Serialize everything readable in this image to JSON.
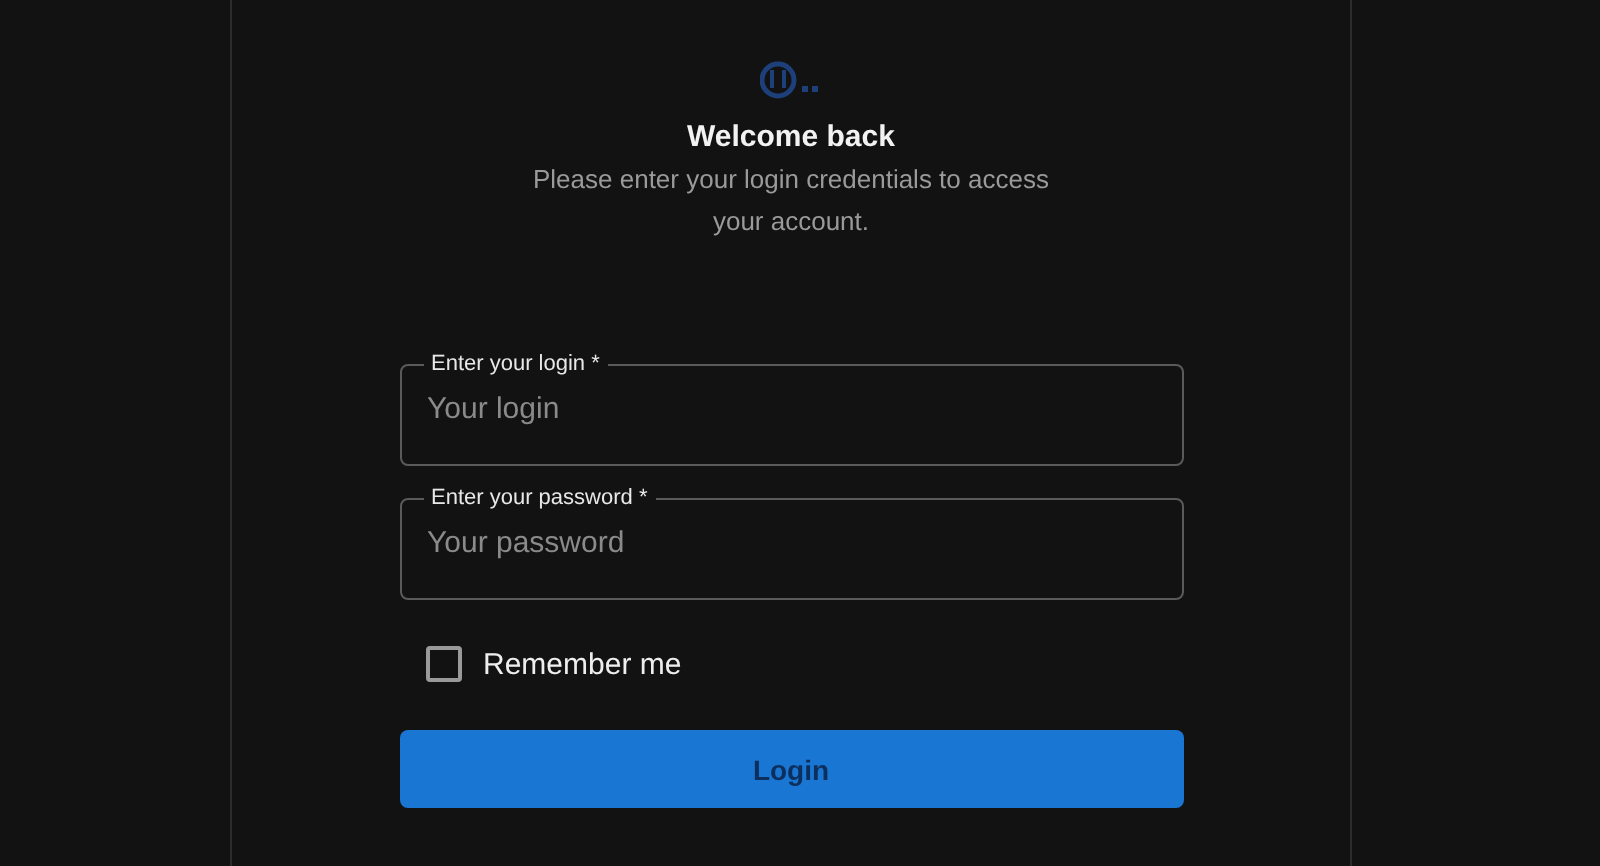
{
  "title": "Welcome back",
  "subtitle": "Please enter your login credentials to access your account.",
  "fields": [
    {
      "label": "Enter your login",
      "required_mark": "*",
      "placeholder": "Your login"
    },
    {
      "label": "Enter your password",
      "required_mark": "*",
      "placeholder": "Your password"
    }
  ],
  "remember": {
    "label": "Remember me",
    "checked": false
  },
  "submit": {
    "label": "Login"
  }
}
